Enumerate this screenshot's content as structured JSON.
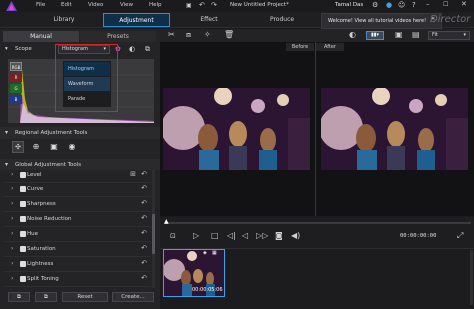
{
  "window": {
    "menu": [
      "File",
      "Edit",
      "Video",
      "View",
      "Help"
    ],
    "project_title": "New Untitled Project*",
    "user_name": "Tamal Das",
    "brand_text": "Director"
  },
  "main_tabs": [
    {
      "label": "Library"
    },
    {
      "label": "Adjustment"
    },
    {
      "label": "Effect"
    },
    {
      "label": "Produce"
    }
  ],
  "toast": {
    "text": "Welcome! View all tutorial videos here!"
  },
  "left_panel": {
    "tabs": [
      {
        "label": "Manual"
      },
      {
        "label": "Presets"
      }
    ],
    "scope": {
      "title": "Scope",
      "selected": "Histogram",
      "options": [
        "Histogram",
        "Waveform",
        "Parade"
      ],
      "channel_labels": [
        "RGB",
        "R",
        "G",
        "B"
      ]
    },
    "regional_title": "Regional Adjustment Tools",
    "global_title": "Global Adjustment Tools",
    "tools": [
      "Level",
      "Curve",
      "Sharpness",
      "Noise Reduction",
      "Hue",
      "Saturation",
      "Lightness",
      "Split Toning"
    ],
    "buttons": {
      "reset": "Reset",
      "create": "Create..."
    }
  },
  "preview": {
    "before_label": "Before",
    "after_label": "After",
    "fit_label": "Fit",
    "timecode": "00:00:00:00"
  },
  "filmstrip": {
    "clip_time": "00:00:05:06"
  },
  "colors": {
    "accent": "#2a8fd6",
    "highlight": "#d42626"
  }
}
